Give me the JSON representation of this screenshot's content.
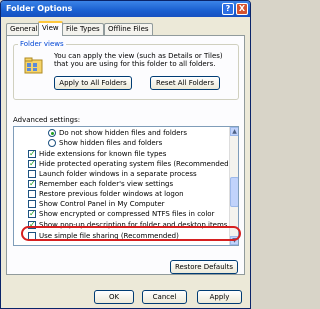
{
  "window": {
    "title": "Folder Options",
    "help_glyph": "?",
    "close_glyph": "X"
  },
  "tabs": [
    {
      "label": "General"
    },
    {
      "label": "View"
    },
    {
      "label": "File Types"
    },
    {
      "label": "Offline Files"
    }
  ],
  "folder_views": {
    "title": "Folder views",
    "description": "You can apply the view (such as Details or Tiles) that you are using for this folder to all folders.",
    "apply_button": "Apply to All Folders",
    "reset_button": "Reset All Folders"
  },
  "advanced": {
    "title": "Advanced settings:",
    "items": [
      {
        "label": "Do not show hidden files and folders",
        "kind": "radio",
        "checked": true
      },
      {
        "label": "Show hidden files and folders",
        "kind": "radio",
        "checked": false
      },
      {
        "label": "Hide extensions for known file types",
        "kind": "checkbox",
        "checked": true
      },
      {
        "label": "Hide protected operating system files (Recommended)",
        "kind": "checkbox",
        "checked": true
      },
      {
        "label": "Launch folder windows in a separate process",
        "kind": "checkbox",
        "checked": false
      },
      {
        "label": "Remember each folder's view settings",
        "kind": "checkbox",
        "checked": true
      },
      {
        "label": "Restore previous folder windows at logon",
        "kind": "checkbox",
        "checked": false
      },
      {
        "label": "Show Control Panel in My Computer",
        "kind": "checkbox",
        "checked": false
      },
      {
        "label": "Show encrypted or compressed NTFS files in color",
        "kind": "checkbox",
        "checked": true
      },
      {
        "label": "Show pop-up description for folder and desktop items",
        "kind": "checkbox",
        "checked": true
      },
      {
        "label": "Use simple file sharing (Recommended)",
        "kind": "checkbox",
        "checked": false
      }
    ],
    "restore_button": "Restore Defaults"
  },
  "footer": {
    "ok": "OK",
    "cancel": "Cancel",
    "apply": "Apply"
  },
  "colors": {
    "title_bar": "#1a5fd0",
    "annotation": "#d62020"
  }
}
